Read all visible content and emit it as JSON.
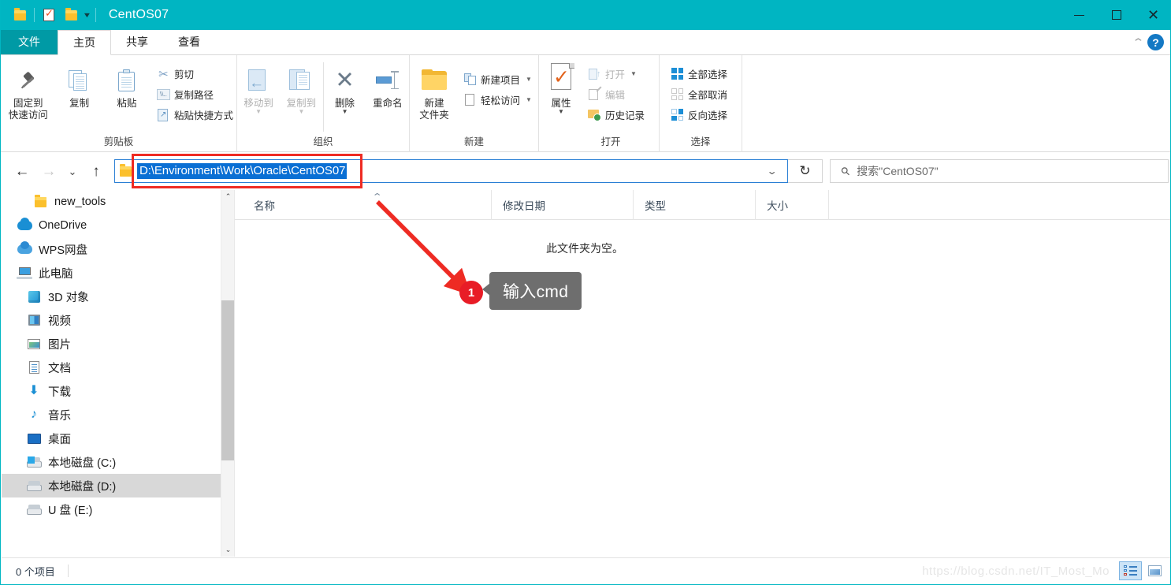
{
  "window": {
    "title": "CentOS07",
    "quick_access": [
      "folder-icon",
      "properties-icon",
      "new-folder-icon"
    ],
    "controls": {
      "minimize": "—",
      "maximize": "□",
      "close": "✕"
    }
  },
  "tabs": [
    {
      "label": "文件",
      "id": "file"
    },
    {
      "label": "主页",
      "id": "home"
    },
    {
      "label": "共享",
      "id": "share"
    },
    {
      "label": "查看",
      "id": "view"
    }
  ],
  "ribbon": {
    "collapse_label": "⌃",
    "help_label": "?",
    "groups": [
      {
        "name": "剪贴板",
        "big_buttons": [
          {
            "label": "固定到\n快速访问",
            "line1": "固定到",
            "line2": "快速访问",
            "icon": "pin-icon",
            "disabled": false
          },
          {
            "label": "复制",
            "icon": "copy-icon",
            "disabled": false
          },
          {
            "label": "粘贴",
            "icon": "paste-icon",
            "disabled": false
          }
        ],
        "small_buttons": [
          {
            "label": "剪切",
            "icon": "scissors-icon",
            "disabled": false
          },
          {
            "label": "复制路径",
            "icon": "copy-path-icon",
            "disabled": false
          },
          {
            "label": "粘贴快捷方式",
            "icon": "paste-shortcut-icon",
            "disabled": false
          }
        ]
      },
      {
        "name": "组织",
        "big_buttons": [
          {
            "label": "移动到",
            "icon": "move-to-icon",
            "disabled": true,
            "has_caret": true
          },
          {
            "label": "复制到",
            "icon": "copy-to-icon",
            "disabled": true,
            "has_caret": true
          },
          {
            "label": "删除",
            "icon": "delete-icon",
            "disabled": false,
            "has_caret": true
          },
          {
            "label": "重命名",
            "icon": "rename-icon",
            "disabled": false
          }
        ]
      },
      {
        "name": "新建",
        "big_buttons": [
          {
            "label": "新建\n文件夹",
            "line1": "新建",
            "line2": "文件夹",
            "icon": "new-folder-icon",
            "disabled": false
          }
        ],
        "small_buttons": [
          {
            "label": "新建项目",
            "icon": "new-item-icon",
            "has_caret": true
          },
          {
            "label": "轻松访问",
            "icon": "easy-access-icon",
            "has_caret": true
          }
        ]
      },
      {
        "name": "打开",
        "big_buttons": [
          {
            "label": "属性",
            "icon": "properties-icon",
            "disabled": false,
            "has_caret": true
          }
        ],
        "small_buttons": [
          {
            "label": "打开",
            "icon": "open-icon",
            "disabled": true,
            "has_caret": true
          },
          {
            "label": "编辑",
            "icon": "edit-icon",
            "disabled": true
          },
          {
            "label": "历史记录",
            "icon": "history-icon",
            "disabled": false
          }
        ]
      },
      {
        "name": "选择",
        "small_buttons": [
          {
            "label": "全部选择",
            "icon": "select-all-icon"
          },
          {
            "label": "全部取消",
            "icon": "select-none-icon"
          },
          {
            "label": "反向选择",
            "icon": "invert-selection-icon"
          }
        ]
      }
    ]
  },
  "addressbar": {
    "back": "←",
    "forward": "→",
    "recent": "⌄",
    "up": "↑",
    "path_value": "D:\\Environment\\Work\\Oracle\\CentOS07",
    "dropdown": "⌄",
    "refresh": "↻",
    "highlight_color": "#ee2b23",
    "selection_color": "#0a6fd4"
  },
  "search": {
    "icon": "search-icon",
    "placeholder": "搜索\"CentOS07\""
  },
  "sidebar": {
    "items": [
      {
        "label": "new_tools",
        "icon": "folder-icon",
        "level": 1,
        "selected": false
      },
      {
        "label": "OneDrive",
        "icon": "onedrive-cloud-icon",
        "level": 0,
        "selected": false
      },
      {
        "label": "WPS网盘",
        "icon": "wps-cloud-icon",
        "level": 0,
        "selected": false
      },
      {
        "label": "此电脑",
        "icon": "this-pc-icon",
        "level": 0,
        "selected": false
      },
      {
        "label": "3D 对象",
        "icon": "3d-objects-icon",
        "level": 2,
        "selected": false
      },
      {
        "label": "视频",
        "icon": "videos-icon",
        "level": 2,
        "selected": false
      },
      {
        "label": "图片",
        "icon": "pictures-icon",
        "level": 2,
        "selected": false
      },
      {
        "label": "文档",
        "icon": "documents-icon",
        "level": 2,
        "selected": false
      },
      {
        "label": "下载",
        "icon": "downloads-icon",
        "level": 2,
        "selected": false
      },
      {
        "label": "音乐",
        "icon": "music-icon",
        "level": 2,
        "selected": false
      },
      {
        "label": "桌面",
        "icon": "desktop-icon",
        "level": 2,
        "selected": false
      },
      {
        "label": "本地磁盘 (C:)",
        "icon": "windows-drive-icon",
        "level": 2,
        "selected": false
      },
      {
        "label": "本地磁盘 (D:)",
        "icon": "drive-icon",
        "level": 2,
        "selected": true
      },
      {
        "label": "U 盘 (E:)",
        "icon": "drive-icon",
        "level": 2,
        "selected": false
      }
    ],
    "scroll_up": "⌃",
    "scroll_down": "⌄"
  },
  "filelist": {
    "columns": [
      {
        "label": "名称",
        "sorted": true,
        "sort_caret": "⌃"
      },
      {
        "label": "修改日期"
      },
      {
        "label": "类型"
      },
      {
        "label": "大小"
      }
    ],
    "empty_message": "此文件夹为空。",
    "rows": []
  },
  "annotation": {
    "badge_number": "1",
    "tooltip_text": "输入cmd",
    "arrow_color": "#ee2b23",
    "tooltip_bg": "#6e6e6e"
  },
  "statusbar": {
    "item_count": "0 个项目",
    "watermark": "https://blog.csdn.net/IT_Most_Mo",
    "views": [
      {
        "name": "details-view",
        "active": true
      },
      {
        "name": "large-icons-view",
        "active": false
      }
    ]
  }
}
